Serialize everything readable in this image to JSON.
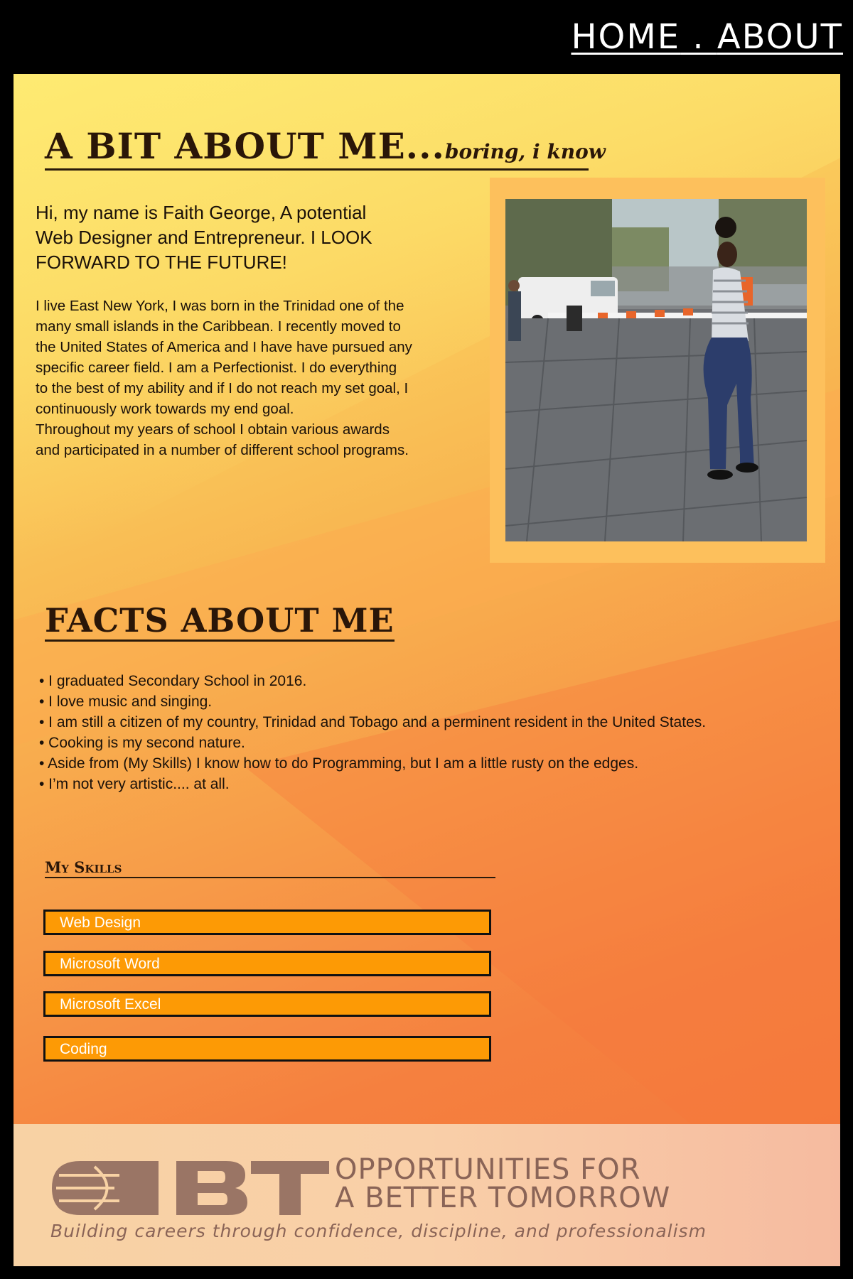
{
  "nav": {
    "home": "HOME",
    "separator": " . ",
    "about": "ABOUT"
  },
  "about": {
    "heading": "A BIT ABOUT ME...",
    "heading_sub": "boring, i know",
    "intro": "Hi, my name is Faith George, A potential Web Designer and Entrepreneur. I LOOK FORWARD TO THE FUTURE!",
    "bio_1": "I live East New York, I was born in the Trinidad one of the many small islands in the Caribbean. I recently moved to the United States of America and I have have pursued any specific career field. I am a Perfectionist. I do everything to the best of my ability and if I do not reach my set goal, I continuously work towards my end goal.",
    "bio_2": "Throughout my years of school I obtain various awards and participated in a number of different school programs."
  },
  "facts": {
    "heading": "FACTS ABOUT ME",
    "items": [
      "• I graduated Secondary School in 2016.",
      "• I love music and singing.",
      "• I am still a citizen of my country, Trinidad and Tobago and a perminent resident in the United States.",
      "• Cooking is my second nature.",
      "• Aside from (My Skills) I know how to do Programming, but I am a little rusty on the edges.",
      "• I’m not very artistic.... at all."
    ]
  },
  "skills": {
    "heading": "My Skills",
    "items": [
      "Web Design",
      "Microsoft Word",
      "Microsoft Excel",
      "Coding"
    ]
  },
  "footer": {
    "logo_text": "OBT",
    "line1": "OPPORTUNITIES FOR",
    "line2": "A BETTER TOMORROW",
    "tagline": "Building careers through confidence, discipline, and professionalism"
  },
  "colors": {
    "skill_bar": "#fd9a05",
    "footer_text": "#8a6457",
    "heading_text": "#2a1608"
  }
}
